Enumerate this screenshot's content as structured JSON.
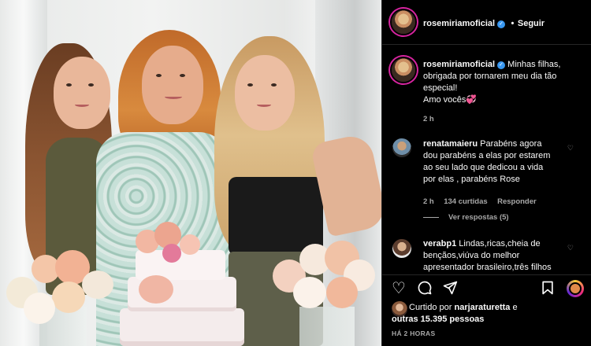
{
  "post": {
    "username": "rosemiriamoficial",
    "follow_label": "Seguir",
    "dot": "•"
  },
  "caption": {
    "username": "rosemiriamoficial",
    "text_line1": "Minhas filhas,",
    "text_line2": "obrigada por tornarem meu dia tão",
    "text_line3": "especial!",
    "text_line4": "Amo vocês💞",
    "time": "2 h"
  },
  "comments": [
    {
      "username": "renatamaieru",
      "line1": "Parabéns agora",
      "line2": "dou parabéns a elas por estarem",
      "line3": "ao seu lado que dedicou a vida",
      "line4": "por elas , parabéns Rose",
      "time": "2 h",
      "likes": "134 curtidas",
      "reply": "Responder",
      "view_replies": "Ver respostas (5)"
    },
    {
      "username": "verabp1",
      "line1": "Lindas,ricas,cheia de",
      "line2": "bençãos,viúva do melhor",
      "line3": "apresentador brasileiro,três filhos"
    }
  ],
  "likes": {
    "prefix": "Curtido por",
    "user": "narjaraturetta",
    "conj": "e",
    "others": "outras 15.395 pessoas"
  },
  "timestamp": "HÁ 2 HORAS",
  "icons": {
    "like": "heart-icon",
    "comment": "comment-icon",
    "share": "share-icon",
    "save": "bookmark-icon",
    "verified": "verified-icon"
  },
  "colors": {
    "background": "#000000",
    "text": "#fafafa",
    "muted": "#a8a8a8",
    "verified": "#3897f0",
    "divider": "#262626"
  }
}
